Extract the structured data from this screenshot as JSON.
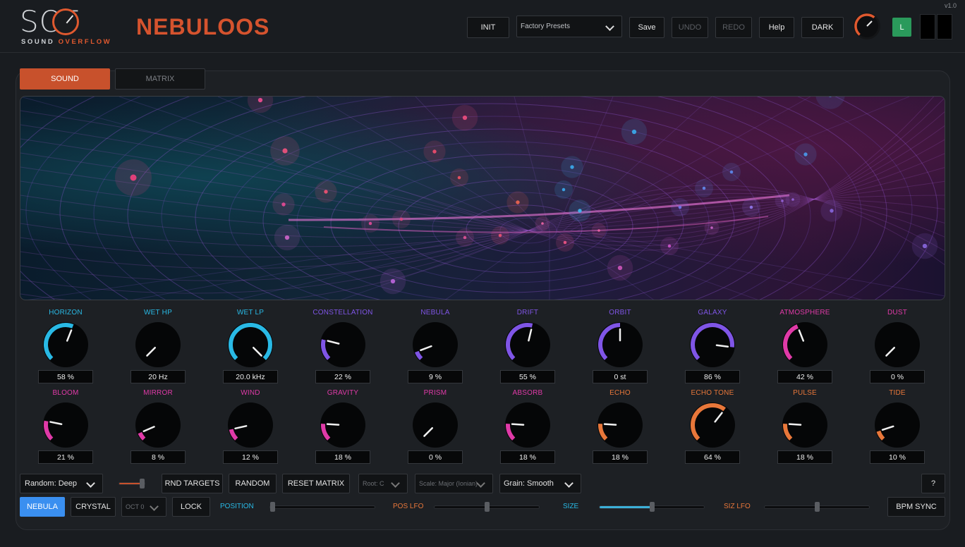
{
  "header": {
    "logo_letters": "SOF",
    "logo_sub_a": "SOUND ",
    "logo_sub_b": "OVERFLOW",
    "product": "NEBULOOS",
    "version": "v1.0",
    "init": "INIT",
    "preset": "Factory Presets",
    "save": "Save",
    "undo": "UNDO",
    "redo": "REDO",
    "help": "Help",
    "theme": "DARK",
    "lock_l": "L"
  },
  "tabs": {
    "sound": "SOUND",
    "matrix": "MATRIX"
  },
  "colors": {
    "cyan": "#29b9e5",
    "purple": "#7f55e6",
    "magenta": "#e03aa8",
    "orange": "#e8773a",
    "accent": "#c8512c",
    "green": "#2a9a5b"
  },
  "knobs_row1": [
    {
      "label": "HORIZON",
      "value": "58 %",
      "norm": 0.58,
      "color": "#29b9e5"
    },
    {
      "label": "WET HP",
      "value": "20 Hz",
      "norm": 0.0,
      "color": "#29b9e5"
    },
    {
      "label": "WET LP",
      "value": "20.0 kHz",
      "norm": 1.0,
      "color": "#29b9e5"
    },
    {
      "label": "CONSTELLATION",
      "value": "22 %",
      "norm": 0.22,
      "color": "#7f55e6"
    },
    {
      "label": "NEBULA",
      "value": "9 %",
      "norm": 0.09,
      "color": "#7f55e6"
    },
    {
      "label": "DRIFT",
      "value": "55 %",
      "norm": 0.55,
      "color": "#7f55e6"
    },
    {
      "label": "ORBIT",
      "value": "0 st",
      "norm": 0.5,
      "color": "#7f55e6"
    },
    {
      "label": "GALAXY",
      "value": "86 %",
      "norm": 0.86,
      "color": "#7f55e6"
    },
    {
      "label": "ATMOSPHERE",
      "value": "42 %",
      "norm": 0.42,
      "color": "#e03aa8"
    },
    {
      "label": "DUST",
      "value": "0 %",
      "norm": 0.0,
      "color": "#e03aa8"
    }
  ],
  "knobs_row2": [
    {
      "label": "BLOOM",
      "value": "21 %",
      "norm": 0.21,
      "color": "#e03aa8"
    },
    {
      "label": "MIRROR",
      "value": "8 %",
      "norm": 0.08,
      "color": "#e03aa8"
    },
    {
      "label": "WIND",
      "value": "12 %",
      "norm": 0.12,
      "color": "#e03aa8"
    },
    {
      "label": "GRAVITY",
      "value": "18 %",
      "norm": 0.18,
      "color": "#e03aa8"
    },
    {
      "label": "PRISM",
      "value": "0 %",
      "norm": 0.0,
      "color": "#e03aa8"
    },
    {
      "label": "ABSORB",
      "value": "18 %",
      "norm": 0.18,
      "color": "#e03aa8"
    },
    {
      "label": "ECHO",
      "value": "18 %",
      "norm": 0.18,
      "color": "#e8773a"
    },
    {
      "label": "ECHO TONE",
      "value": "64 %",
      "norm": 0.64,
      "color": "#e8773a"
    },
    {
      "label": "PULSE",
      "value": "18 %",
      "norm": 0.18,
      "color": "#e8773a"
    },
    {
      "label": "TIDE",
      "value": "10 %",
      "norm": 0.1,
      "color": "#e8773a"
    }
  ],
  "controls": {
    "random_mode": "Random: Deep",
    "random_amount_norm": 0.9,
    "rnd_targets": "RND TARGETS",
    "random": "RANDOM",
    "reset_matrix": "RESET MATRIX",
    "root": "Root: C",
    "scale": "Scale: Major (Ionian)",
    "grain": "Grain: Smooth",
    "help_q": "?",
    "nebula": "NEBULA",
    "crystal": "CRYSTAL",
    "octave": "OCT 0",
    "lock": "LOCK",
    "position_label": "POSITION",
    "position_norm": 0.0,
    "pos_lfo_label": "POS LFO",
    "pos_lfo_norm": 0.5,
    "size_label": "SIZE",
    "size_norm": 0.5,
    "siz_lfo_label": "SIZ LFO",
    "siz_lfo_norm": 0.5,
    "bpm_sync": "BPM SYNC"
  }
}
